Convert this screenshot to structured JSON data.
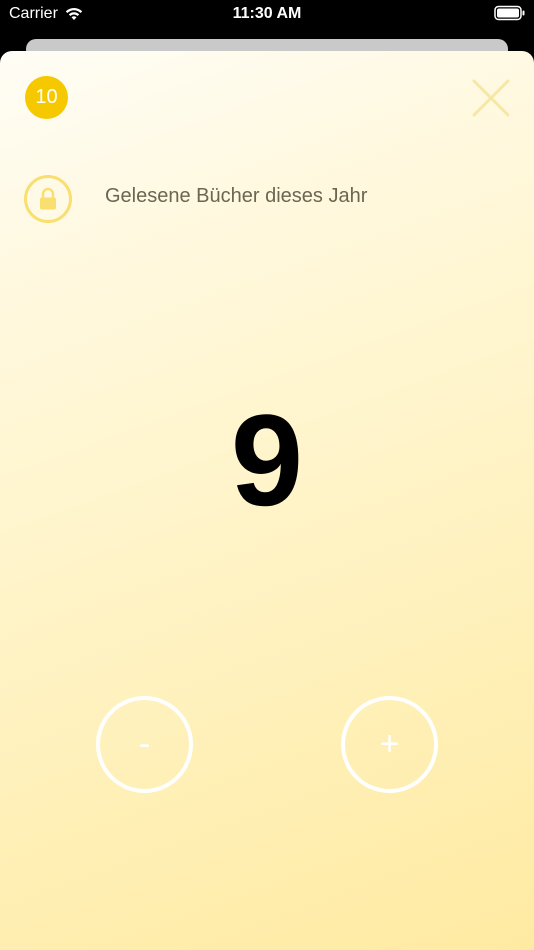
{
  "status_bar": {
    "carrier": "Carrier",
    "time": "11:30 AM"
  },
  "sheet": {
    "badge_count": "10",
    "title": "Gelesene Bücher dieses Jahr",
    "counter_value": "9",
    "decrement_label": "-",
    "increment_label": "+"
  },
  "colors": {
    "badge": "#f6c800",
    "lock_ring": "#f9df70",
    "title_text": "#6b6652",
    "close_icon": "#f6e7a4"
  },
  "icons": [
    "wifi-icon",
    "battery-icon",
    "close-icon",
    "lock-icon"
  ]
}
